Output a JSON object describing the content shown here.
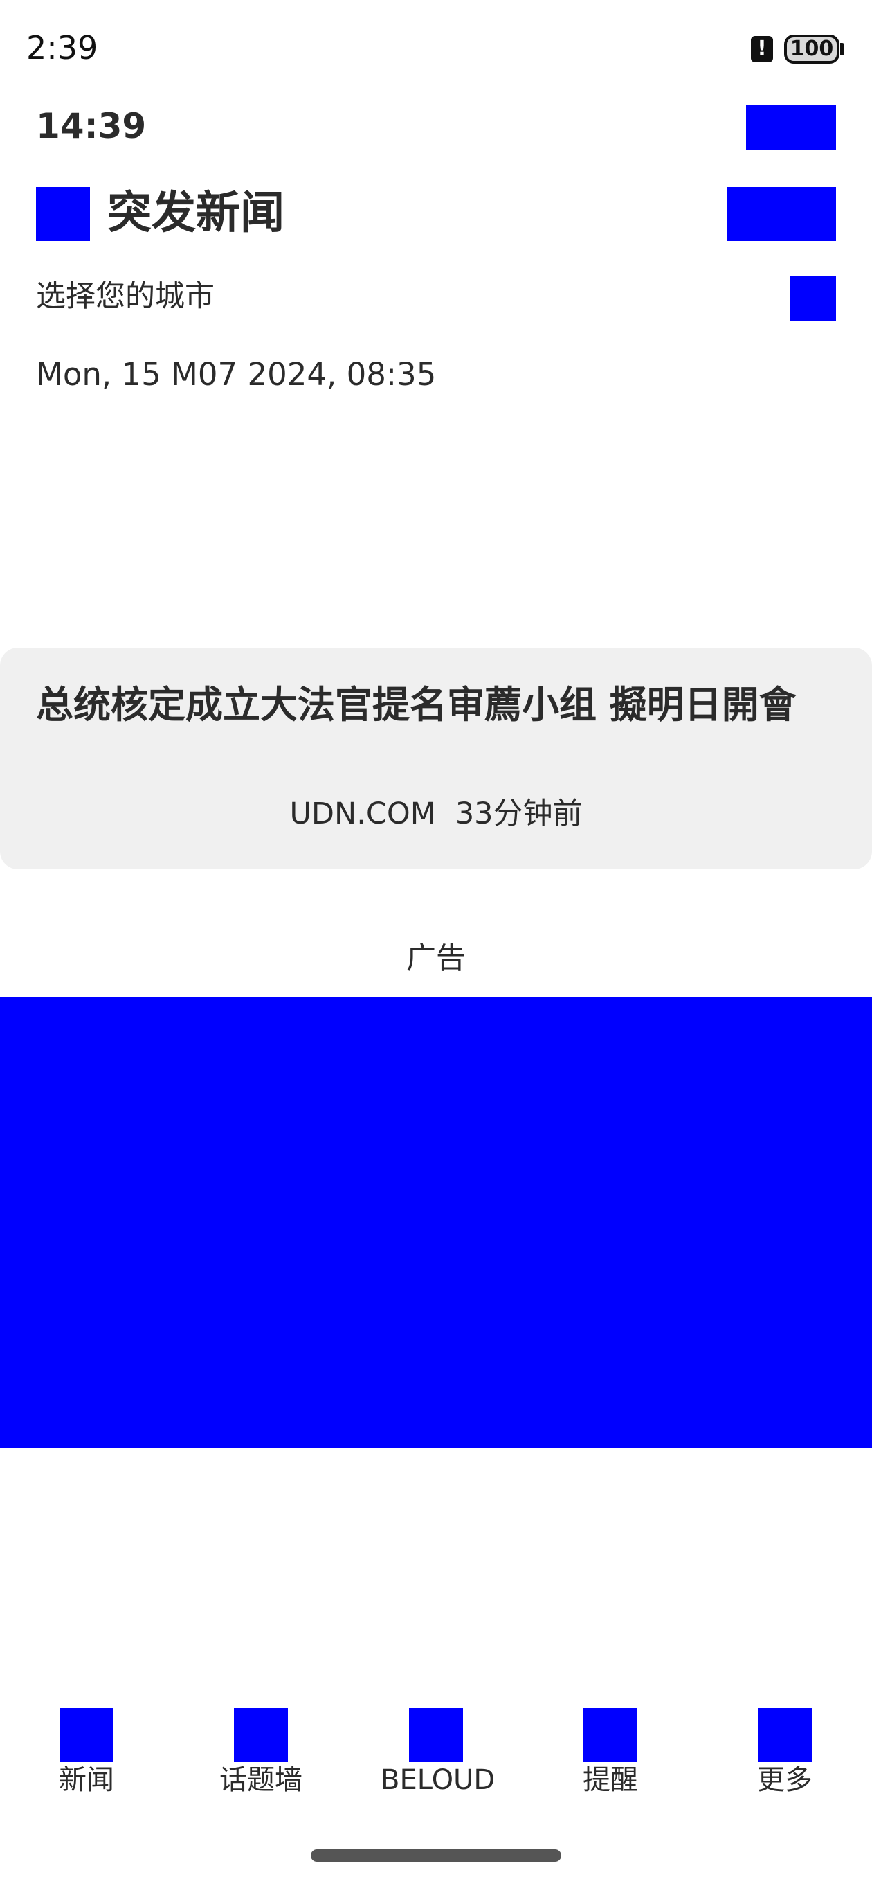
{
  "status_bar": {
    "time": "2:39",
    "alert_glyph": "!",
    "battery_level": "100"
  },
  "header": {
    "clock": "14:39",
    "title": "突发新闻",
    "city_select": "选择您的城市",
    "date": "Mon, 15 M07 2024, 08:35"
  },
  "news_card": {
    "headline": "总统核定成立大法官提名审薦小组 擬明日開會",
    "source": "UDN.COM",
    "time_ago": "33分钟前"
  },
  "ad": {
    "label": "广告"
  },
  "bottom_nav": {
    "items": [
      {
        "label": "新闻"
      },
      {
        "label": "话题墙"
      },
      {
        "label": "BELOUD"
      },
      {
        "label": "提醒"
      },
      {
        "label": "更多"
      }
    ]
  },
  "colors": {
    "placeholder_blue": "#0000ff",
    "card_background": "#f0f0f0",
    "text": "#2b2b2b"
  }
}
